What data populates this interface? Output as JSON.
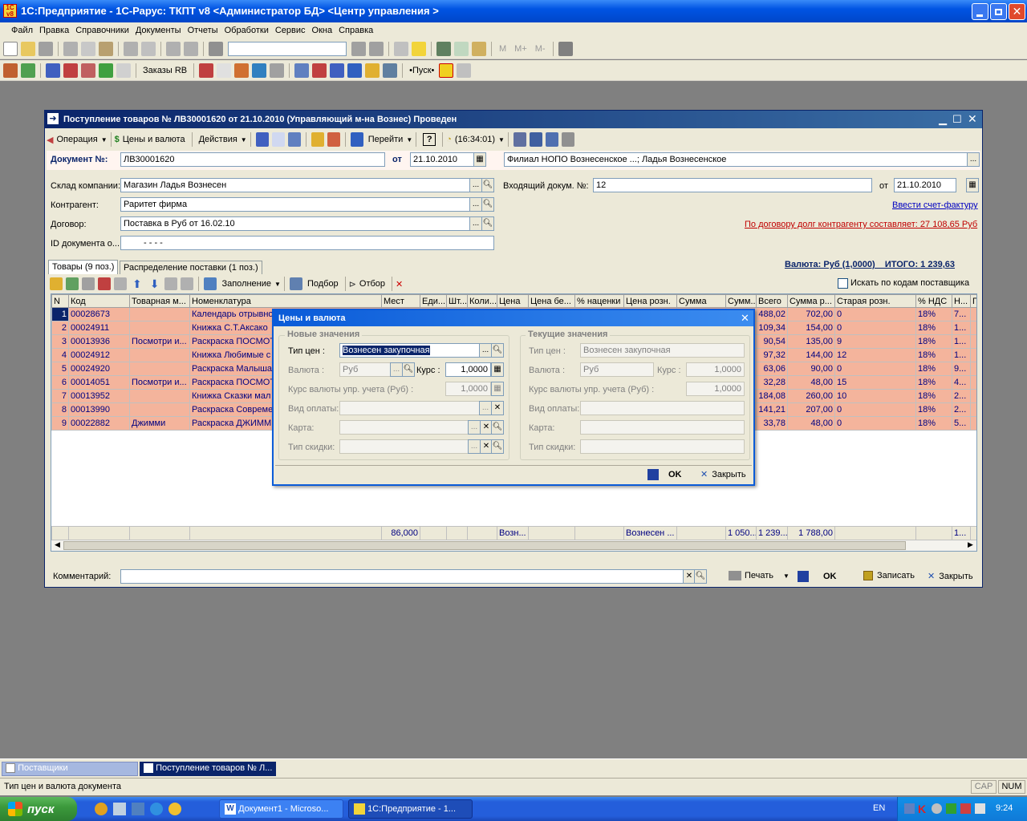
{
  "app": {
    "title": "1С:Предприятие - 1С-Рарус: ТКПТ v8 <Администратор БД> <Центр управления >",
    "menu": [
      "Файл",
      "Правка",
      "Справочники",
      "Документы",
      "Отчеты",
      "Обработки",
      "Сервис",
      "Окна",
      "Справка"
    ],
    "toolbar2_text": "Заказы RB",
    "toolbar2_pusk": "•Пуск•",
    "m_labels": [
      "M",
      "M+",
      "M-"
    ]
  },
  "doc": {
    "title": "Поступление товаров № ЛВ30001620 от 21.10.2010 (Управляющий м-на Вознес) Проведен",
    "toolbar": {
      "operation": "Операция",
      "prices": "Цены и валюта",
      "actions": "Действия",
      "goto": "Перейти",
      "time": "(16:34:01)"
    },
    "doc_no_label": "Документ №:",
    "doc_no": "ЛВ30001620",
    "from_label": "от",
    "date": "21.10.2010",
    "branch": "Филиал НОПО Вознесенское ...; Ладья Вознесенское",
    "warehouse_label": "Склад компании:",
    "warehouse": "Магазин Ладья Вознесен",
    "counterparty_label": "Контрагент:",
    "counterparty": "Раритет фирма",
    "contract_label": "Договор:",
    "contract": "Поставка в Руб от 16.02.10",
    "id_label": "ID документа о...",
    "id_value": "-   -   -   -",
    "incoming_label": "Входящий докум. №:",
    "incoming": "12",
    "incoming_from": "от",
    "incoming_date": "21.10.2010",
    "invoice_link": "Ввести счет-фактуру",
    "debt_text": "По договору долг контрагенту составляет: 27 108,65 Руб",
    "currency_total": "Валюта: Руб (1,0000)    ИТОГО: 1 239,63",
    "tabs": [
      "Товары (9 поз.)",
      "Распределение поставки (1 поз.)"
    ],
    "tab_toolbar": {
      "fill": "Заполнение",
      "pick": "Подбор",
      "select": "Отбор",
      "search_codes": "Искать по кодам поставщика"
    },
    "columns": [
      "N",
      "Код",
      "Товарная м...",
      "Номенклатура",
      "Мест",
      "Еди...",
      "Шт...",
      "Коли...",
      "Цена",
      "Цена бе...",
      "% наценки",
      "Цена розн.",
      "Сумма",
      "Сумм...",
      "Всего",
      "Сумма р...",
      "Старая розн.",
      "% НДС",
      "Н...",
      "П"
    ],
    "rows": [
      {
        "n": "1",
        "code": "00028673",
        "brand": "",
        "name": "Календарь отрывно",
        "total": "488,02",
        "sum_r": "702,00",
        "old": "0",
        "vat": "18%",
        "h": "7..."
      },
      {
        "n": "2",
        "code": "00024911",
        "brand": "",
        "name": "Книжка С.Т.Аксако",
        "total": "109,34",
        "sum_r": "154,00",
        "old": "0",
        "vat": "18%",
        "h": "1..."
      },
      {
        "n": "3",
        "code": "00013936",
        "brand": "Посмотри и...",
        "name": "Раскраска ПОСМОТ",
        "total": "90,54",
        "sum_r": "135,00",
        "old": "9",
        "vat": "18%",
        "h": "1..."
      },
      {
        "n": "4",
        "code": "00024912",
        "brand": "",
        "name": "Книжка Любимые с",
        "total": "97,32",
        "sum_r": "144,00",
        "old": "12",
        "vat": "18%",
        "h": "1..."
      },
      {
        "n": "5",
        "code": "00024920",
        "brand": "",
        "name": "Раскраска Малыша",
        "total": "63,06",
        "sum_r": "90,00",
        "old": "0",
        "vat": "18%",
        "h": "9..."
      },
      {
        "n": "6",
        "code": "00014051",
        "brand": "Посмотри и...",
        "name": "Раскраска ПОСМОТ",
        "total": "32,28",
        "sum_r": "48,00",
        "old": "15",
        "vat": "18%",
        "h": "4..."
      },
      {
        "n": "7",
        "code": "00013952",
        "brand": "",
        "name": "Книжка Сказки мал",
        "total": "184,08",
        "sum_r": "260,00",
        "old": "10",
        "vat": "18%",
        "h": "2..."
      },
      {
        "n": "8",
        "code": "00013990",
        "brand": "",
        "name": "Раскраска Совреме",
        "total": "141,21",
        "sum_r": "207,00",
        "old": "0",
        "vat": "18%",
        "h": "2..."
      },
      {
        "n": "9",
        "code": "00022882",
        "brand": "Джимми",
        "name": "Раскраска ДЖИММ",
        "total": "33,78",
        "sum_r": "48,00",
        "old": "0",
        "vat": "18%",
        "h": "5..."
      }
    ],
    "footer": {
      "places": "86,000",
      "price": "Возн...",
      "retail": "Вознесен ...",
      "summ": "1 050...",
      "total": "1 239...",
      "sum_r": "1 788,00",
      "h": "1..."
    },
    "comment_label": "Комментарий:",
    "print": "Печать",
    "ok": "OK",
    "save": "Записать",
    "close": "Закрыть"
  },
  "dialog": {
    "title": "Цены и валюта",
    "new_group": "Новые значения",
    "cur_group": "Текущие значения",
    "price_type_label": "Тип цен :",
    "price_type": "Вознесен закупочная",
    "currency_label": "Валюта :",
    "currency": "Руб",
    "rate_label": "Курс :",
    "rate": "1,0000",
    "mgmt_rate_label": "Курс валюты упр. учета (Руб) :",
    "mgmt_rate": "1,0000",
    "payment_label": "Вид оплаты:",
    "card_label": "Карта:",
    "discount_label": "Тип скидки:",
    "cur_price_type_label": "Тип цен :",
    "cur_price_type": "Вознесен закупочная",
    "cur_currency_label": "Валюта :",
    "cur_currency": "Руб",
    "cur_rate_label": "Курс :",
    "cur_rate": "1,0000",
    "cur_mgmt_rate_label": "Курс валюты упр. учета (Руб) :",
    "cur_mgmt_rate": "1,0000",
    "cur_payment_label": "Вид оплаты:",
    "cur_card_label": "Карта:",
    "cur_discount_label": "Тип скидки:",
    "ok": "OK",
    "close": "Закрыть"
  },
  "windows_bar": [
    "Поставщики",
    "Поступление товаров № Л..."
  ],
  "status": {
    "text": "Тип цен и валюта документа",
    "cap": "CAP",
    "num": "NUM"
  },
  "taskbar": {
    "start": "пуск",
    "tasks": [
      "Документ1 - Microso...",
      "1С:Предприятие - 1..."
    ],
    "lang": "EN",
    "time": "9:24"
  },
  "colors": {
    "title_blue": "#0a246a",
    "row_bg": "#f4b49c",
    "xp_taskbar": "#245edb",
    "start_green": "#3c9a3c"
  }
}
